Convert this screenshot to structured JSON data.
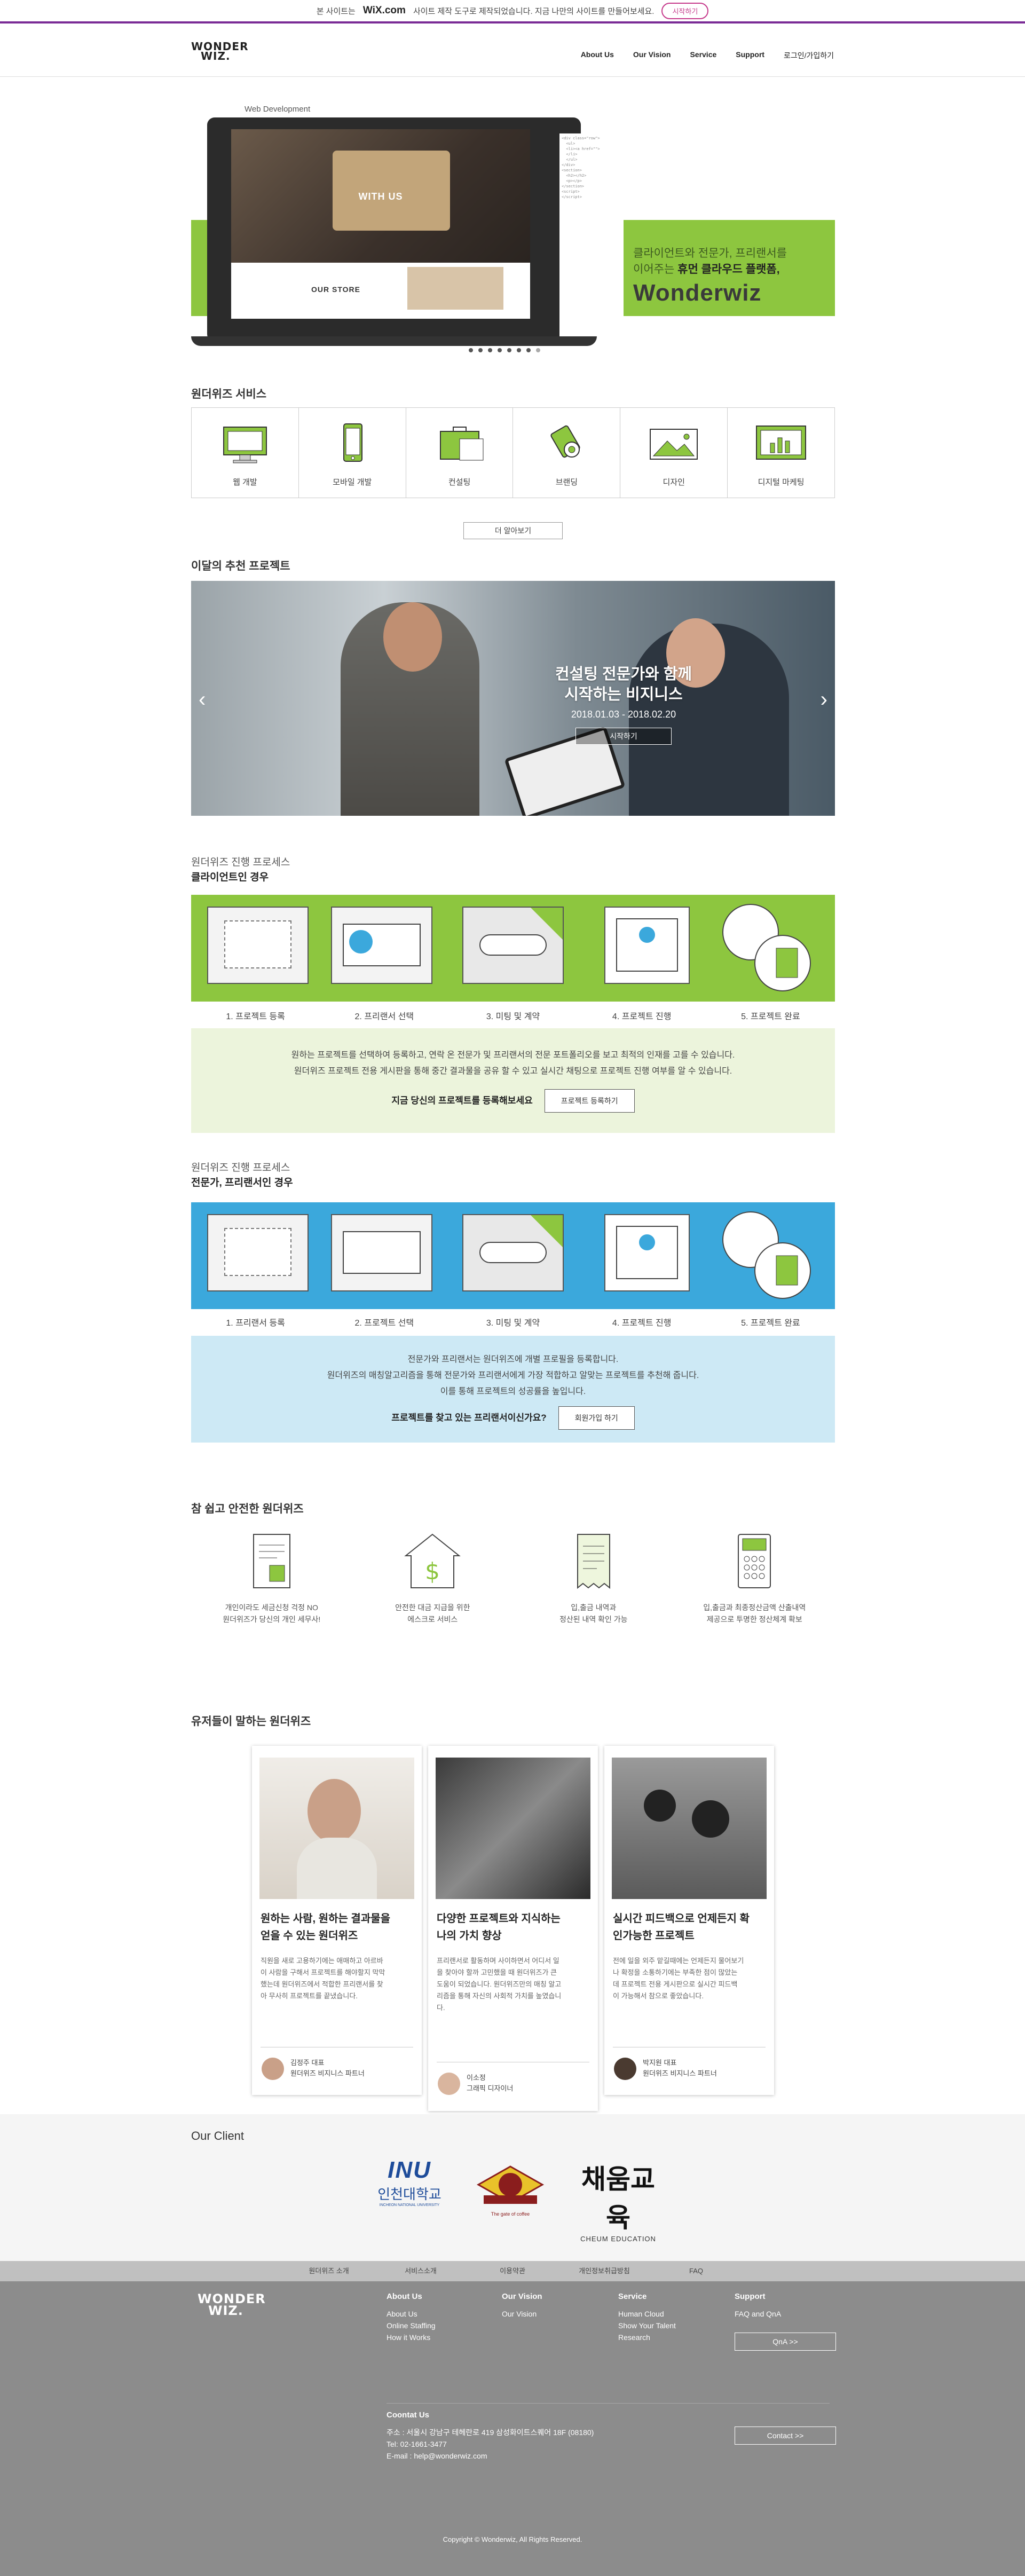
{
  "wix_banner": {
    "text_pre": "본 사이트는",
    "brand": "WiX.com",
    "text_post": "사이트 제작 도구로 제작되었습니다. 지금 나만의 사이트를 만들어보세요.",
    "button": "시작하기"
  },
  "header": {
    "logo_line1": "WONDER",
    "logo_line2": "WIZ.",
    "nav": [
      "About Us",
      "Our Vision",
      "Service",
      "Support"
    ],
    "login": "로그인/가입하기"
  },
  "hero": {
    "label": "Web Development",
    "screen_title": "WITH US",
    "screen_store": "OUR STORE",
    "line1": "클라이언트와 전문가, 프리랜서를",
    "line2_pre": "이어주는",
    "line2_bold": "휴먼 클라우드 플랫폼,",
    "brand": "Wonderwiz",
    "slides": 8,
    "active_slide": 7
  },
  "services": {
    "title": "원더위즈 서비스",
    "items": [
      "웹 개발",
      "모바일 개발",
      "컨설팅",
      "브랜딩",
      "디자인",
      "디지털 마케팅"
    ],
    "more_button": "더 알아보기"
  },
  "recommended": {
    "title": "이달의 추천 프로젝트",
    "headline_1": "컨설팅 전문가와 함께",
    "headline_2": "시작하는 비지니스",
    "dates": "2018.01.03 - 2018.02.20",
    "button": "시작하기"
  },
  "client_process": {
    "subtitle": "원더위즈 진행 프로세스",
    "title": "클라이언트인 경우",
    "steps": [
      "1. 프로젝트 등록",
      "2. 프리랜서 선택",
      "3. 미팅 및 계약",
      "4. 프로젝트 진행",
      "5. 프로젝트 완료"
    ],
    "desc_1": "원하는 프로젝트를 선택하여 등록하고, 연락 온 전문가 및 프리랜서의 전문 포트폴리오를 보고 최적의 인재를 고를 수 있습니다.",
    "desc_2": "원더위즈 프로젝트 전용 게시판을 통해 중간 결과물을 공유 할 수 있고 실시간 채팅으로 프로젝트 진행 여부를 알 수 있습니다.",
    "cta_text": "지금 당신의 프로젝트를 등록해보세요",
    "cta_button": "프로젝트 등록하기",
    "accent": "#8dc63f",
    "box_bg": "#ecf4dc"
  },
  "pro_process": {
    "subtitle": "원더위즈 진행 프로세스",
    "title": "전문가, 프리랜서인 경우",
    "steps": [
      "1. 프리랜서 등록",
      "2. 프로젝트 선택",
      "3. 미팅 및 계약",
      "4. 프로젝트 진행",
      "5. 프로젝트 완료"
    ],
    "desc_1": "전문가와 프리랜서는 원더위즈에 개별 프로필을 등록합니다.",
    "desc_2": "원더위즈의 매칭알고리즘을 통해 전문가와 프리랜서에게 가장 적합하고 알맞는 프로젝트를 추천해 줍니다.",
    "desc_3": "이를 통해 프로젝트의 성공률을 높입니다.",
    "cta_text": "프로젝트를 찾고 있는 프리랜서이신가요?",
    "cta_button": "회원가입 하기",
    "accent": "#3ba8dc",
    "box_bg": "#cde9f5"
  },
  "safe": {
    "title": "참 쉽고 안전한 원더위즈",
    "items": [
      {
        "l1": "개인이라도 세금신청 걱정 NO",
        "l2": "원더위즈가 당신의 개인 세무사!"
      },
      {
        "l1": "안전한 대금 지급을 위한",
        "l2": "에스크로 서비스"
      },
      {
        "l1": "입,출금 내역과",
        "l2": "정산된 내역 확인 가능"
      },
      {
        "l1": "입,출금과 최종정산금액 산출내역",
        "l2": "제공으로 투명한 정산체계 확보"
      }
    ]
  },
  "testimonials": {
    "title": "유저들이 말하는 원더위즈",
    "cards": [
      {
        "title_1": "원하는 사람, 원하는 결과물을",
        "title_2": "얻을 수 있는 원더위즈",
        "body": [
          "직원을 새로 고용하기에는 애매하고 아르바",
          "이 사람을 구해서 프로젝트를 해야할지 막막",
          "했는데 원더위즈에서 적합한 프리랜서를 찾",
          "아 무사히 프로젝트를 끝냈습니다."
        ],
        "name": "김정주 대표",
        "role": "원더위즈 비지니스 파트너"
      },
      {
        "title_1": "다양한 프로젝트와 지식하는",
        "title_2": "나의 가치 향상",
        "body": [
          "프리랜서로 활동하며 사이하면서 어디서 일",
          "을 찾아야 할까 고민했을 때 원더위즈가 큰",
          "도움이 되었습니다. 원더위즈만의 매칭 알고",
          "리즘을 통해 자신의 사회적 가치를 높였습니",
          "다."
        ],
        "name": "이소정",
        "role": "그래픽 디자이너"
      },
      {
        "title_1": "실시간 피드백으로 언제든지 확",
        "title_2": "인가능한 프로젝트",
        "body": [
          "전에 일을 외주 맡길때에는 언제든지 물어보기",
          "나 확정을 소통하기에는 부족한 점이 많았는",
          "데 프로젝트 전용 게시판으로 실시간 피드백",
          "이 가능해서 참으로 좋았습니다."
        ],
        "name": "박지원 대표",
        "role": "원더위즈 비지니스 파트너"
      }
    ]
  },
  "clients": {
    "title": "Our Client",
    "inu_letters": "INU",
    "inu_name": "인천대학교",
    "inu_sub": "INCHEON NATIONAL UNIVERSITY",
    "coffee_sub": "The gate of coffee",
    "cheum_name": "채움교육",
    "cheum_sub": "CHEUM EDUCATION"
  },
  "footer_nav": [
    "원더위즈 소개",
    "서비스소개",
    "이용약관",
    "개인정보취급방침",
    "FAQ"
  ],
  "footer": {
    "logo_line1": "WONDER",
    "logo_line2": "WIZ.",
    "about_title": "About Us",
    "about_items": [
      "About Us",
      "Online Staffing",
      "How it Works"
    ],
    "vision_title": "Our Vision",
    "vision_items": [
      "Our Vision"
    ],
    "service_title": "Service",
    "service_items": [
      "Human Cloud",
      "Show Your Talent",
      "Research"
    ],
    "support_title": "Support",
    "support_items": [
      "FAQ and QnA"
    ],
    "qna_button": "QnA >>",
    "contact_title": "Coontat Us",
    "address": "주소 : 서울시 강남구 테헤란로 419 삼성화이트스퀘어 18F (08180)",
    "tel": "Tel: 02-1661-3477",
    "email": "E-mail : help@wonderwiz.com",
    "contact_button": "Contact >>",
    "copyright": "Copyright © Wonderwiz, All Rights Reserved."
  }
}
